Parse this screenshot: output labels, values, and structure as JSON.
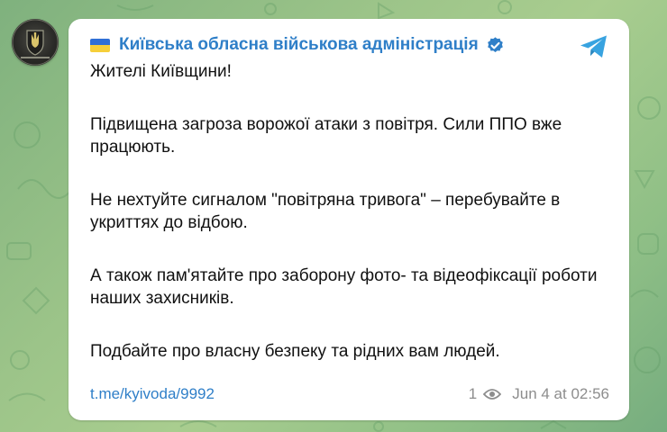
{
  "channel": {
    "name": "Київська обласна військова адміністрація",
    "flag_colors": [
      "#2f6fd6",
      "#f6cf3a"
    ],
    "verified_icon": "verified-badge-icon",
    "avatar_icon": "coat-of-arms-avatar"
  },
  "message": {
    "paragraphs": [
      "Жителі Київщини!",
      "Підвищена загроза ворожої атаки з повітря. Сили ППО вже працюють.",
      "Не нехтуйте сигналом \"повітряна тривога\" – перебувайте в укриттях до відбою.",
      "А також пам'ятайте про заборону фото- та відеофіксації роботи наших захисників.",
      "Подбайте про власну безпеку та рідних вам людей."
    ],
    "link": "t.me/kyivoda/9992",
    "views": "1",
    "timestamp": "Jun 4 at 02:56"
  },
  "icons": {
    "share": "telegram-share-icon",
    "views": "eye-icon"
  },
  "colors": {
    "accent": "#2f7fc8",
    "meta": "#8d8d8d",
    "share_icon": "#38a3e0"
  }
}
